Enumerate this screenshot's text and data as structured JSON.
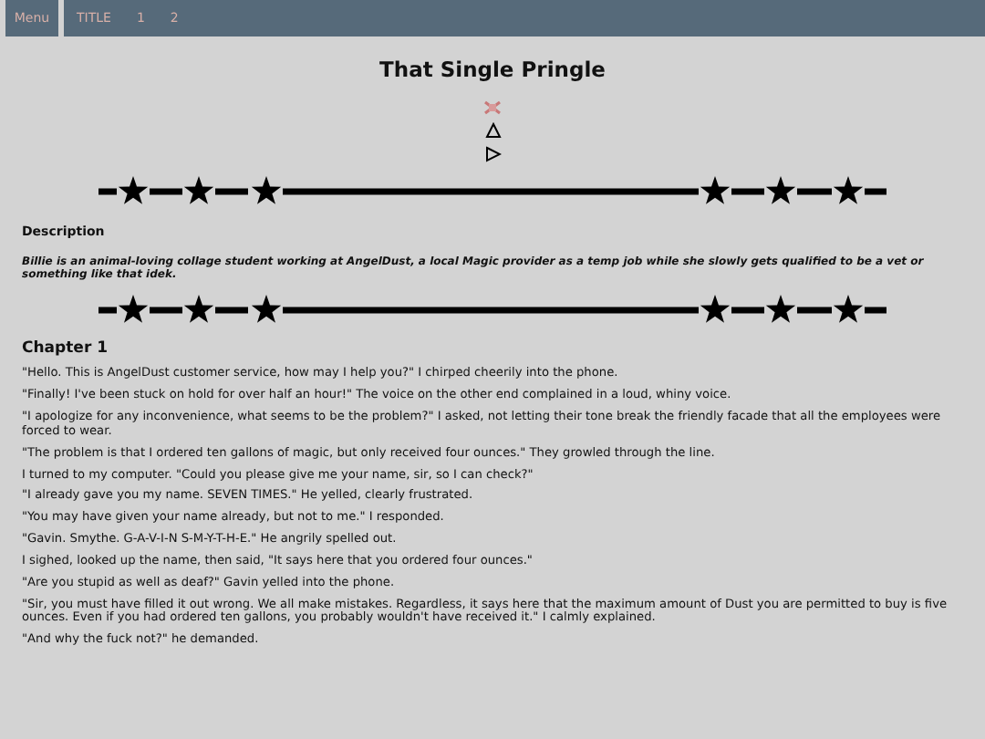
{
  "nav": {
    "menu": "Menu",
    "items": [
      "TITLE",
      "1",
      "2"
    ]
  },
  "title": "That Single Pringle",
  "description": {
    "heading": "Description",
    "text": "Billie is an animal-loving collage student working at AngelDust, a local Magic provider as a temp job while she slowly gets qualified to be a vet or something like that idek."
  },
  "chapter": {
    "heading": "Chapter 1",
    "paragraphs": [
      "\"Hello. This is AngelDust customer service, how may I help you?\" I chirped cheerily into the phone.",
      "\"Finally! I've been stuck on hold for over half an hour!\" The voice on the other end complained in a loud, whiny voice.",
      "\"I apologize for any inconvenience, what seems to be the problem?\" I asked, not letting their tone break the friendly facade that all the employees were forced to wear.",
      "\"The problem is that I ordered ten gallons of magic, but only received four ounces.\" They growled through the line.",
      "I turned to my computer. \"Could you please give me your name, sir, so I can check?\"",
      "\"I already gave you my name. SEVEN TIMES.\" He yelled, clearly frustrated.",
      "\"You may have given your name already, but not to me.\" I responded.",
      "\"Gavin. Smythe. G-A-V-I-N S-M-Y-T-H-E.\" He angrily spelled out.",
      "I sighed, looked up the name, then said, \"It says here that you ordered four ounces.\"",
      "\"Are you stupid as well as deaf?\" Gavin yelled into the phone.",
      "\"Sir, you must have filled it out wrong. We all make mistakes. Regardless, it says here that the maximum amount of Dust you are permitted to buy is five ounces. Even if you had ordered ten gallons, you probably wouldn't have received it.\" I calmly explained.",
      "\"And why the fuck not?\" he demanded."
    ]
  }
}
